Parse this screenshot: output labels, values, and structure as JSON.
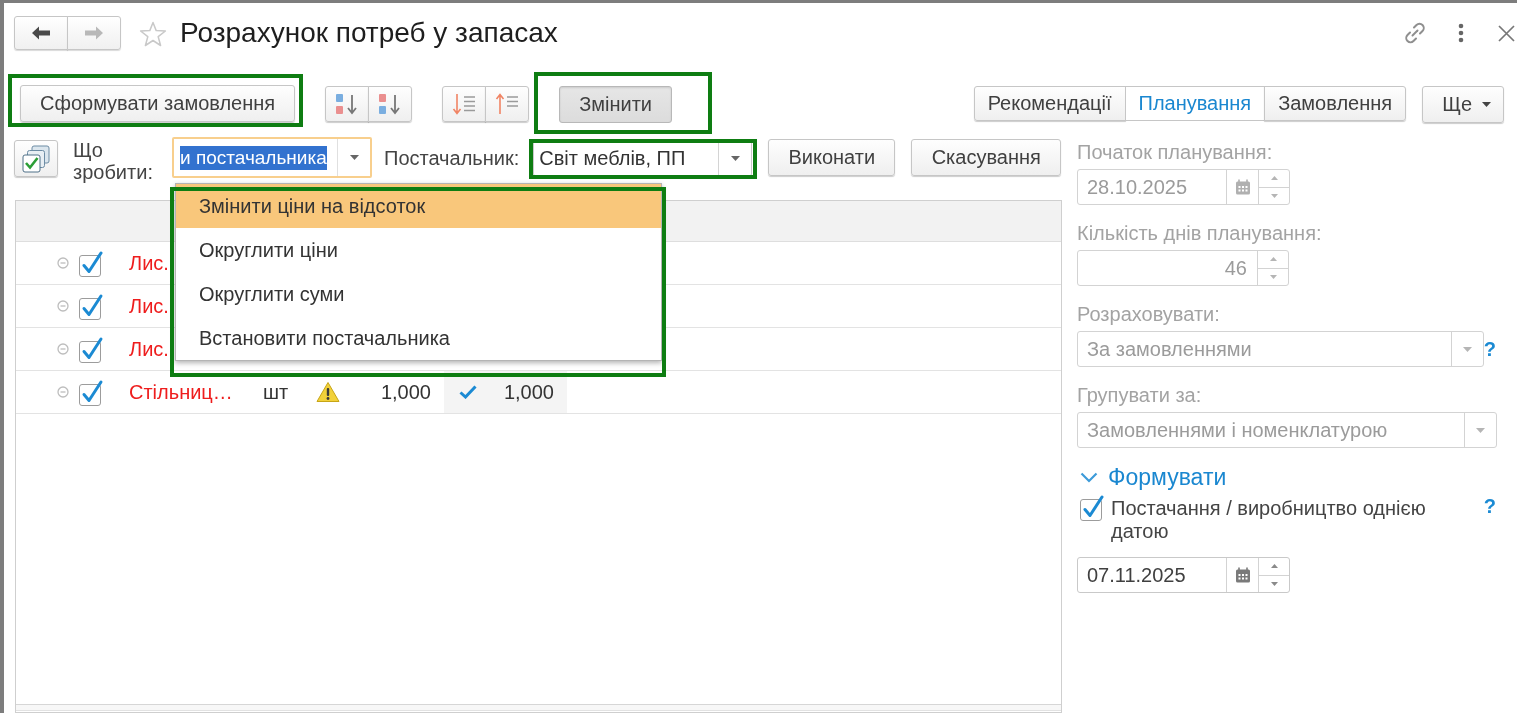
{
  "window": {
    "title": "Розрахунок потреб у запасах",
    "favorite": false
  },
  "navigation": [
    {
      "kind": "back",
      "disabled": false
    },
    {
      "kind": "forward",
      "disabled": true
    }
  ],
  "toolbar": {
    "create_order": {
      "label": "Сформувати замовлення",
      "highlighted": true
    },
    "change": {
      "label": "Змінити",
      "highlighted": true,
      "pressed": true
    },
    "views": [
      {
        "label": "Рекомендації",
        "selected": false
      },
      {
        "label": "Планування",
        "selected": true
      },
      {
        "label": "Замовлення",
        "selected": false
      }
    ],
    "more": {
      "label": "Ще"
    }
  },
  "action_bar": {
    "action_label": "Що зробити:",
    "action_field": {
      "value": "и постачальника",
      "focused": true
    },
    "supplier_label": "Постачальник:",
    "supplier_field": {
      "value": "Світ меблів, ПП",
      "highlighted": true
    },
    "buttons": [
      "Виконати",
      "Скасування"
    ]
  },
  "action_menu": {
    "highlighted": true,
    "items": [
      {
        "label": "Змінити ціни на відсоток",
        "selected": true
      },
      {
        "label": "Округлити ціни",
        "selected": false
      },
      {
        "label": "Округлити суми",
        "selected": false
      },
      {
        "label": "Встановити постачальника",
        "selected": false
      }
    ]
  },
  "table": {
    "rows": [
      {
        "checked": true,
        "column_3": "Лис."
      },
      {
        "checked": true,
        "column_3": "Лис."
      },
      {
        "checked": true,
        "column_3": "Лис."
      },
      {
        "checked": true,
        "column_3": "Стільниц…",
        "column_4": "шт",
        "warning": true,
        "column_6": "1,000",
        "confirmed": true,
        "column_8": "1,000"
      }
    ]
  },
  "planning": {
    "fields": [
      {
        "kind": "date",
        "label": "Початок планування:",
        "value": "28.10.2025",
        "disabled": true
      },
      {
        "kind": "number",
        "label": "Кількість днів планування:",
        "value": "46",
        "disabled": true
      },
      {
        "kind": "select",
        "label": "Розраховувати:",
        "value": "За замовленнями",
        "disabled": true,
        "help": "?"
      },
      {
        "kind": "select",
        "label": "Групувати за:",
        "value": "Замовленнями і номенклатурою",
        "disabled": true
      }
    ]
  },
  "generate": {
    "title": "Формувати",
    "expanded": true,
    "single_date": {
      "label": "Постачання / виробництво однією датою",
      "checked": true,
      "help": "?"
    },
    "date": {
      "kind": "date",
      "value": "07.11.2025",
      "disabled": false
    }
  }
}
